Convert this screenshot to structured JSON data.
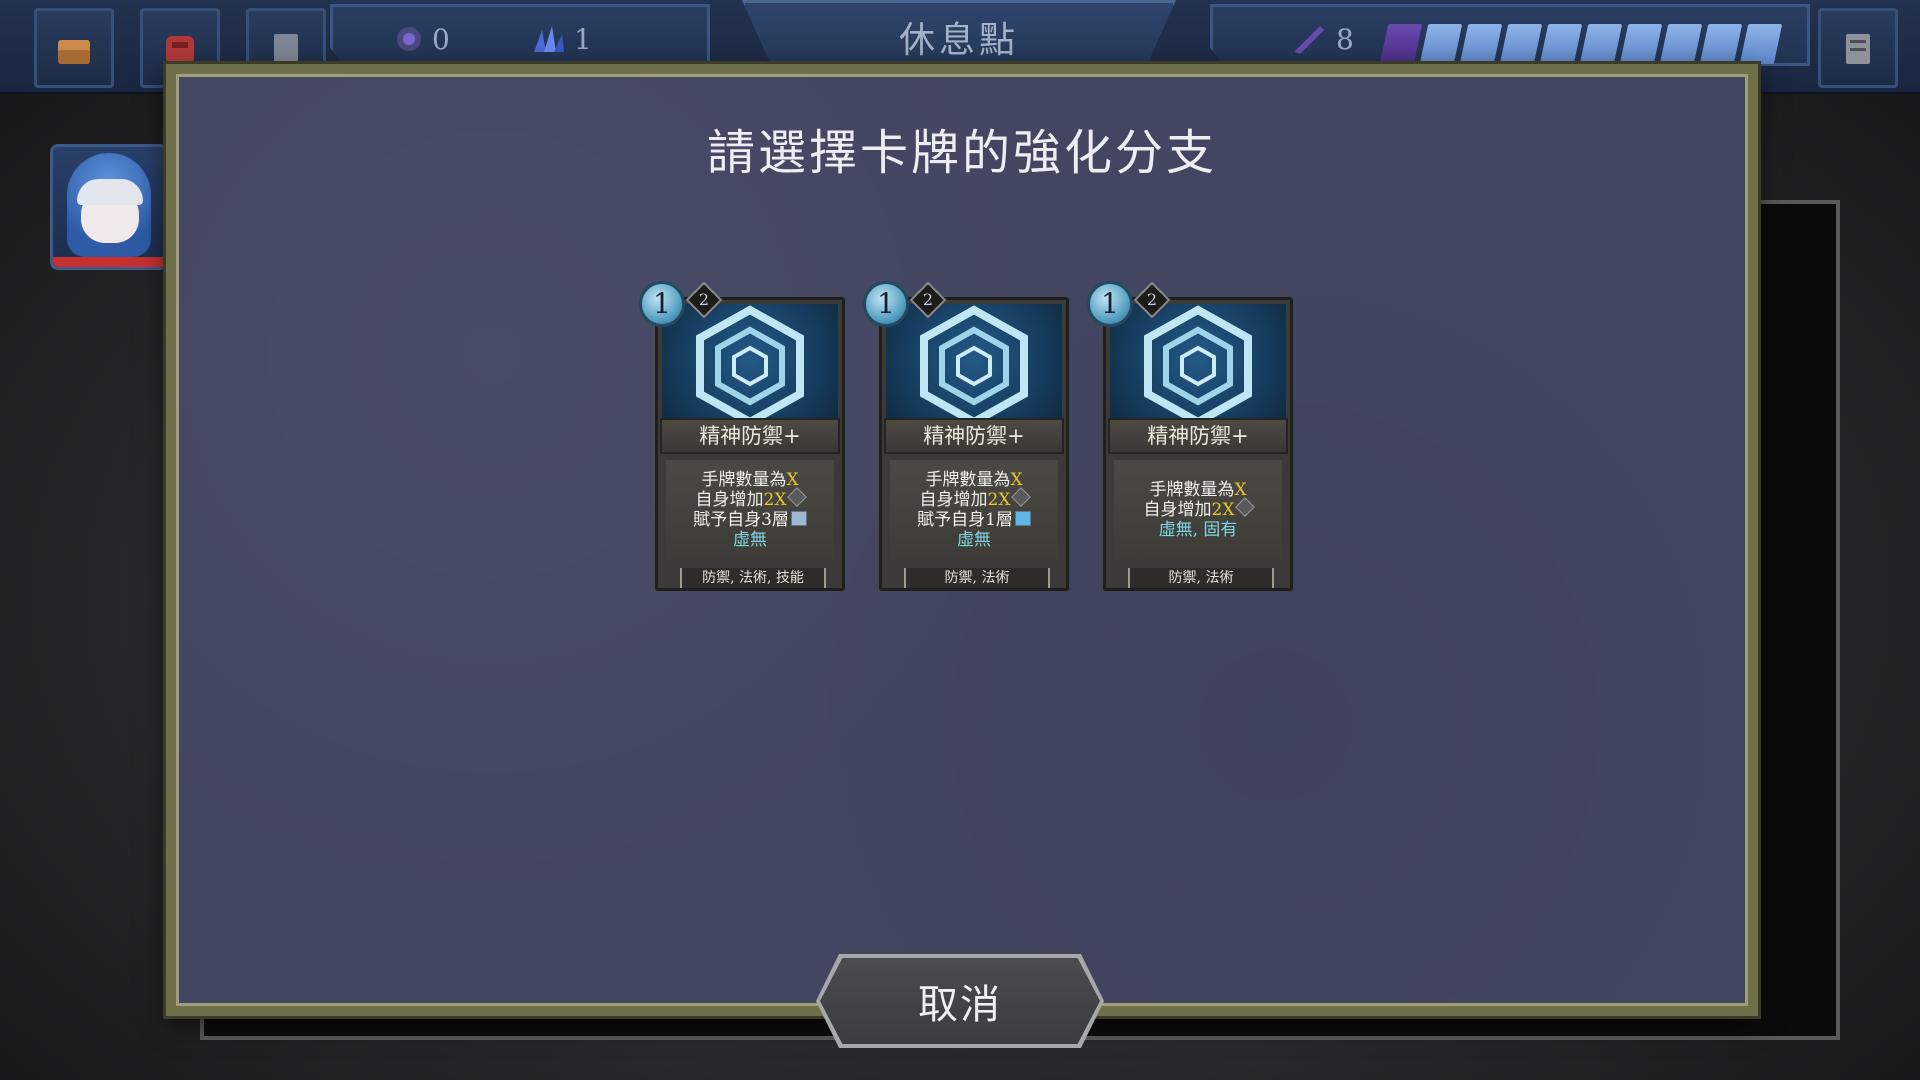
{
  "topbar": {
    "location_title": "休息點",
    "resource_1_value": "0",
    "resource_2_value": "1",
    "deck_count": "8",
    "hp_segments_filled": 9
  },
  "dialog": {
    "title": "請選擇卡牌的強化分支"
  },
  "cards": [
    {
      "cost": "1",
      "badge": "2",
      "name": "精神防禦+",
      "line1_prefix": "手牌數量為",
      "line1_kw": "X",
      "line2_prefix": "自身增加",
      "line2_kw": "2X",
      "line3": "賦予自身3層",
      "line4": "虛無",
      "tags": "防禦, 法術, 技能"
    },
    {
      "cost": "1",
      "badge": "2",
      "name": "精神防禦+",
      "line1_prefix": "手牌數量為",
      "line1_kw": "X",
      "line2_prefix": "自身增加",
      "line2_kw": "2X",
      "line3": "賦予自身1層",
      "line4": "虛無",
      "tags": "防禦, 法術"
    },
    {
      "cost": "1",
      "badge": "2",
      "name": "精神防禦+",
      "line1_prefix": "手牌數量為",
      "line1_kw": "X",
      "line2_prefix": "自身增加",
      "line2_kw": "2X",
      "line4": "虛無, 固有",
      "tags": "防禦, 法術"
    }
  ],
  "cancel_label": "取消",
  "colors": {
    "dialog_bg": "#434661",
    "dialog_frame": "#6f6f4a",
    "keyword_yellow": "#e8c72e",
    "keyword_cyan": "#7fd6e3"
  }
}
